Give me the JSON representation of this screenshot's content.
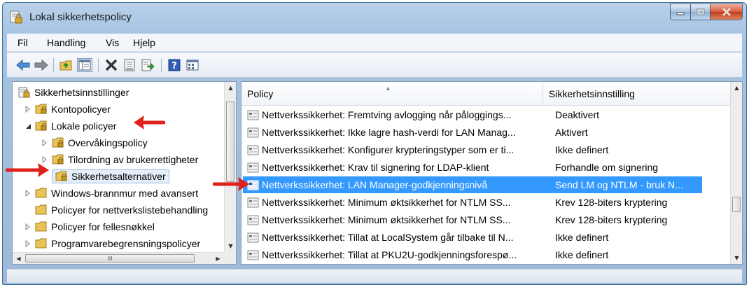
{
  "window": {
    "title": "Lokal sikkerhetspolicy"
  },
  "menu": {
    "items": [
      "Fil",
      "Handling",
      "Vis",
      "Hjelp"
    ]
  },
  "toolbar": {
    "buttons": [
      "back-arrow-icon",
      "forward-arrow-icon",
      "up-folder-icon",
      "show-hide-tree-icon",
      "delete-icon",
      "properties-icon",
      "export-list-icon",
      "help-icon",
      "view-icon"
    ]
  },
  "tree": {
    "root": "Sikkerhetsinnstillinger",
    "items": [
      {
        "label": "Kontopolicyer",
        "level": 1,
        "expanded": false
      },
      {
        "label": "Lokale policyer",
        "level": 1,
        "expanded": true
      },
      {
        "label": "Overvåkingspolicy",
        "level": 2,
        "expanded": false
      },
      {
        "label": "Tilordning av brukerrettigheter",
        "level": 2,
        "expanded": false
      },
      {
        "label": "Sikkerhetsalternativer",
        "level": 2,
        "expanded": false,
        "selected": true
      },
      {
        "label": "Windows-brannmur med avansert",
        "level": 1,
        "expanded": false
      },
      {
        "label": "Policyer for nettverkslistebehandling",
        "level": 1,
        "expanded": false
      },
      {
        "label": "Policyer for fellesnøkkel",
        "level": 1,
        "expanded": false
      },
      {
        "label": "Programvarebegrensningspolicyer",
        "level": 1,
        "expanded": false
      }
    ],
    "hscroll_label": "III"
  },
  "list": {
    "columns": [
      "Policy",
      "Sikkerhetsinnstilling"
    ],
    "rows": [
      {
        "policy": "Nettverkssikkerhet: Fremtving avlogging når påloggings...",
        "setting": "Deaktivert"
      },
      {
        "policy": "Nettverkssikkerhet: Ikke lagre hash-verdi for LAN Manag...",
        "setting": "Aktivert"
      },
      {
        "policy": "Nettverkssikkerhet: Konfigurer krypteringstyper som er ti...",
        "setting": "Ikke definert"
      },
      {
        "policy": "Nettverkssikkerhet: Krav til signering for LDAP-klient",
        "setting": "Forhandle om signering"
      },
      {
        "policy": "Nettverkssikkerhet: LAN Manager-godkjenningsnivå",
        "setting": "Send LM og NTLM - bruk N...",
        "selected": true
      },
      {
        "policy": "Nettverkssikkerhet: Minimum øktsikkerhet for NTLM SS...",
        "setting": "Krev 128-biters kryptering"
      },
      {
        "policy": "Nettverkssikkerhet: Minimum øktsikkerhet for NTLM SS...",
        "setting": "Krev 128-biters kryptering"
      },
      {
        "policy": "Nettverkssikkerhet: Tillat at LocalSystem går tilbake til N...",
        "setting": "Ikke definert"
      },
      {
        "policy": "Nettverkssikkerhet: Tillat at PKU2U-godkjenningsforespø...",
        "setting": "Ikke definert"
      }
    ]
  },
  "colors": {
    "selection": "#3399ff",
    "annotation_arrow": "#e0201b"
  }
}
